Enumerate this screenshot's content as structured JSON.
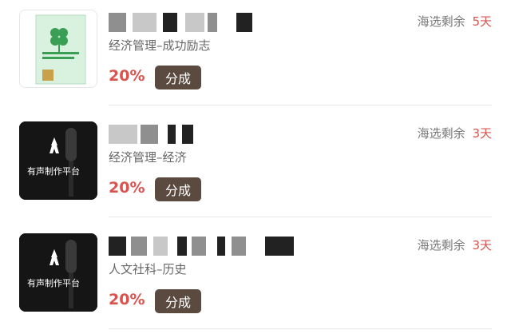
{
  "items": [
    {
      "category": "经济管理–成功励志",
      "rate": "20%",
      "action_label": "分成",
      "remain_label": "海选剩余",
      "remain_days": "5天",
      "cover_icon": "book-cover-green-clover"
    },
    {
      "category": "经济管理–经济",
      "rate": "20%",
      "action_label": "分成",
      "remain_label": "海选剩余",
      "remain_days": "3天",
      "cover_icon": "audio-production-platform-microphone",
      "cover_text": "有声制作平台"
    },
    {
      "category": "人文社科–历史",
      "rate": "20%",
      "action_label": "分成",
      "remain_label": "海选剩余",
      "remain_days": "3天",
      "cover_icon": "audio-production-platform-microphone",
      "cover_text": "有声制作平台"
    }
  ],
  "colors": {
    "accent_red": "#d9534f",
    "button_brown": "#5a4a3f",
    "text_gray": "#666666"
  }
}
